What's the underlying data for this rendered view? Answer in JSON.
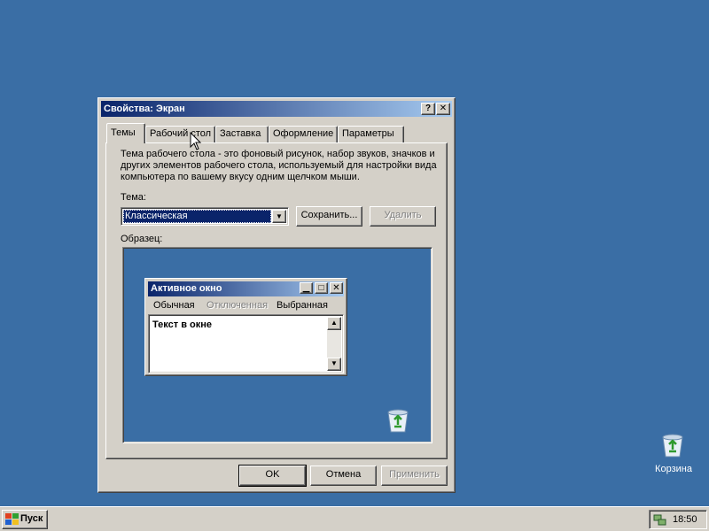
{
  "desktop": {
    "background": "#3a6ea5",
    "icons": [
      {
        "label": "Корзина",
        "icon": "recycle-bin-icon"
      }
    ]
  },
  "dialog": {
    "title": "Свойства: Экран",
    "help_button": "?",
    "close_button": "✕",
    "tabs": [
      {
        "label": "Темы",
        "active": true
      },
      {
        "label": "Рабочий стол",
        "active": false
      },
      {
        "label": "Заставка",
        "active": false
      },
      {
        "label": "Оформление",
        "active": false
      },
      {
        "label": "Параметры",
        "active": false
      }
    ],
    "description": "Тема рабочего стола - это фоновый рисунок, набор звуков, значков и других элементов рабочего стола, используемый для настройки вида компьютера по вашему вкусу одним щелчком мыши.",
    "theme_label": "Тема:",
    "theme_value": "Классическая",
    "save_button": "Сохранить...",
    "delete_button": "Удалить",
    "sample_label": "Образец:",
    "preview": {
      "window_title": "Активное окно",
      "menu": [
        "Обычная",
        "Отключенная",
        "Выбранная"
      ],
      "window_text": "Текст в окне"
    },
    "buttons": {
      "ok": "OK",
      "cancel": "Отмена",
      "apply": "Применить"
    }
  },
  "taskbar": {
    "start_label": "Пуск",
    "clock": "18:50"
  },
  "colors": {
    "desktop": "#3a6ea5",
    "title_active_start": "#0a246a",
    "title_active_end": "#a6caf0",
    "face": "#d4d0c8"
  }
}
